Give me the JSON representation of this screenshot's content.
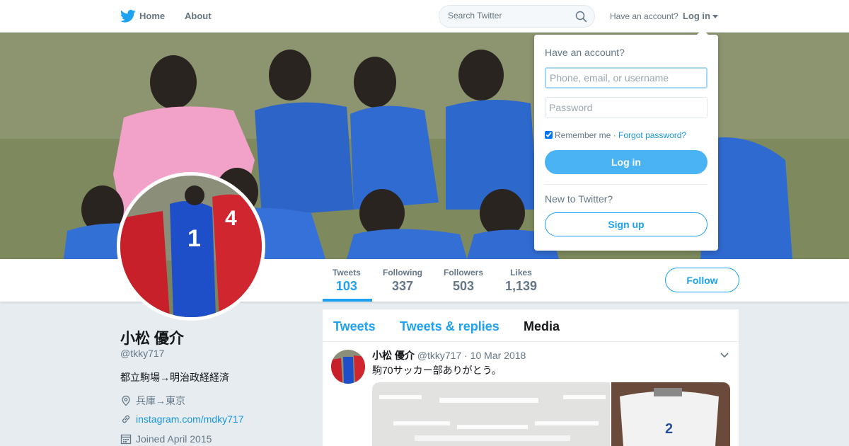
{
  "nav": {
    "home_label": "Home",
    "about_label": "About",
    "search_placeholder": "Search Twitter",
    "have_account": "Have an account?",
    "login_label": "Log in",
    "brand_color": "#1da1f2"
  },
  "profile_nav": {
    "stats": [
      {
        "label": "Tweets",
        "value": "103"
      },
      {
        "label": "Following",
        "value": "337"
      },
      {
        "label": "Followers",
        "value": "503"
      },
      {
        "label": "Likes",
        "value": "1,139"
      }
    ],
    "follow_label": "Follow"
  },
  "profile": {
    "name": "小松 優介",
    "handle": "@tkky717",
    "bio": "都立駒場→明治政経経済",
    "location": "兵庫→東京",
    "website": "instagram.com/mdky717",
    "joined": "Joined April 2015"
  },
  "timeline": {
    "tabs": [
      "Tweets",
      "Tweets & replies",
      "Media"
    ],
    "tweet": {
      "name": "小松 優介",
      "handle": "@tkky717",
      "date": "· 10 Mar 2018",
      "text": "駒70サッカー部ありがとう。"
    }
  },
  "login_dropdown": {
    "title": "Have an account?",
    "username_placeholder": "Phone, email, or username",
    "password_placeholder": "Password",
    "remember_label": "Remember me",
    "separator": "·",
    "forgot_label": "Forgot password?",
    "login_button": "Log in",
    "new_label": "New to Twitter?",
    "signup_button": "Sign up"
  }
}
